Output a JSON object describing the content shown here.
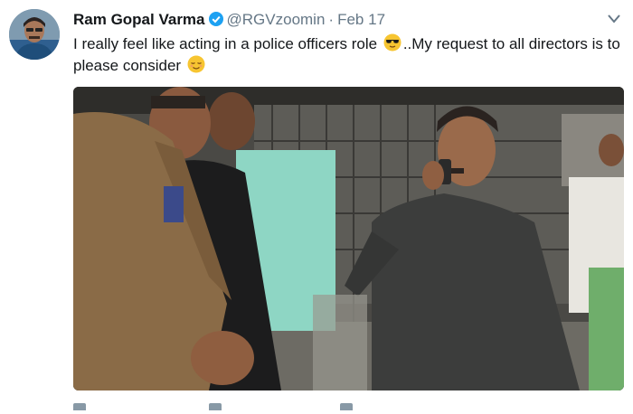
{
  "tweet": {
    "name": "Ram Gopal Varma",
    "handle": "@RGVzoomin",
    "separator": "·",
    "date": "Feb 17",
    "text_part1": "I really feel like acting in a police officers role",
    "text_part2": "..My request to all directors is to please consider",
    "emoji1": "sunglasses-emoji",
    "emoji2": "relieved-emoji"
  },
  "colors": {
    "verified": "#1da1f2",
    "secondary_text": "#657786",
    "primary_text": "#14171a"
  }
}
